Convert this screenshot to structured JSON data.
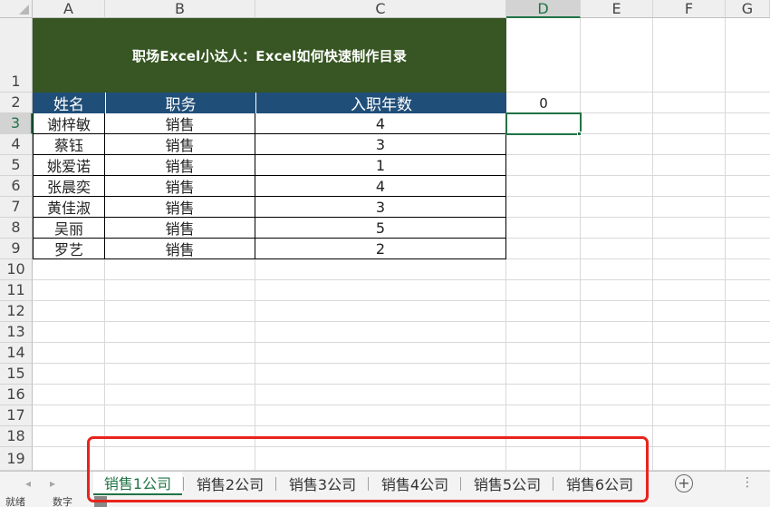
{
  "columns": [
    "A",
    "B",
    "C",
    "D",
    "E",
    "F",
    "G"
  ],
  "rows": [
    "1",
    "2",
    "3",
    "4",
    "5",
    "6",
    "7",
    "8",
    "9",
    "10",
    "11",
    "12",
    "13",
    "14",
    "15",
    "16",
    "17",
    "18",
    "19"
  ],
  "title": "职场Excel小达人：Excel如何快速制作目录",
  "table": {
    "headers": [
      "姓名",
      "职务",
      "入职年数"
    ],
    "rows": [
      [
        "谢梓敏",
        "销售",
        "4"
      ],
      [
        "蔡钰",
        "销售",
        "3"
      ],
      [
        "姚爱诺",
        "销售",
        "1"
      ],
      [
        "张晨奕",
        "销售",
        "4"
      ],
      [
        "黄佳淑",
        "销售",
        "3"
      ],
      [
        "吴丽",
        "销售",
        "5"
      ],
      [
        "罗艺",
        "销售",
        "2"
      ]
    ]
  },
  "d2_value": "0",
  "sheets": {
    "tabs": [
      "销售1公司",
      "销售2公司",
      "销售3公司",
      "销售4公司",
      "销售5公司",
      "销售6公司"
    ],
    "active_index": 0,
    "add_icon": "plus-circle-icon",
    "prev_icon": "◂",
    "next_icon": "▸",
    "more_icon": "⋮"
  },
  "status": {
    "left1": "就绪",
    "left2": "数字"
  },
  "colors": {
    "title_bg": "#375623",
    "header_bg": "#1f4e78",
    "accent": "#217346",
    "annotation": "#e8231d"
  }
}
